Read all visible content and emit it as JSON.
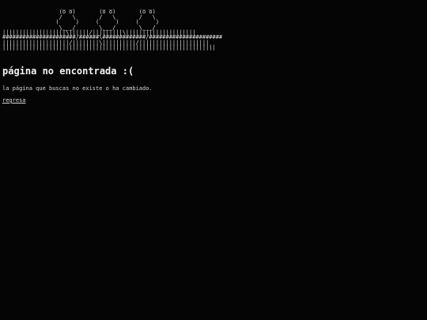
{
  "ascii_art": "                  _ _         _ _         _ _\n                 (o o)       (o o)       (o o)\n                 /   \\       /   \\       /   \\\n                (     )     (     )     (     )\n                 \\___/       \\___/       \\___/\n|||||||||||||||||||\\||||||/|||||||||\\|||||||||||||||||||||\n######################/######\\#############/######################\n||||||||||||||||||||/||||||||\\||||||||||/|||||||||||||||||||||\n||||||||||||||||||||||||||||||||||||||||||||||||||||||||||||||||",
  "heading": "página no encontrada :(",
  "message": "la página que buscas no existe o ha cambiado.",
  "back_link": "regresa"
}
